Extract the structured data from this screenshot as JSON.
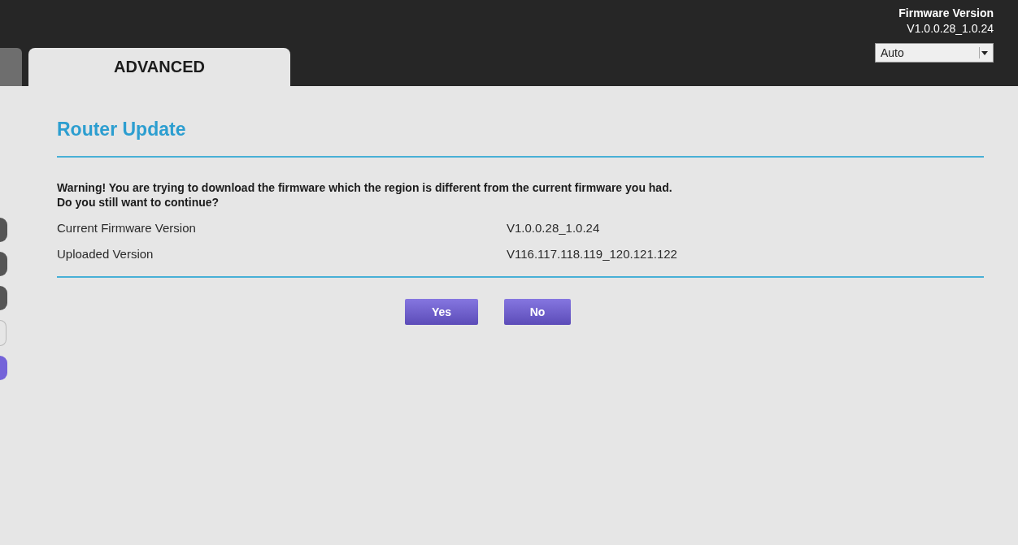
{
  "header": {
    "firmware_label": "Firmware Version",
    "firmware_version": "V1.0.0.28_1.0.24",
    "language_select": {
      "value": "Auto"
    }
  },
  "tabs": [
    {
      "label": "ADVANCED",
      "selected": true
    }
  ],
  "page": {
    "title": "Router Update",
    "warning": [
      "Warning! You are trying to download the firmware which the region is different from the current firmware you had.",
      "Do you still want to continue?"
    ],
    "rows": [
      {
        "label": "Current Firmware Version",
        "value": "V1.0.0.28_1.0.24"
      },
      {
        "label": "Uploaded Version",
        "value": "V116.117.118.119_120.121.122"
      }
    ],
    "buttons": [
      "Yes",
      "No"
    ]
  }
}
